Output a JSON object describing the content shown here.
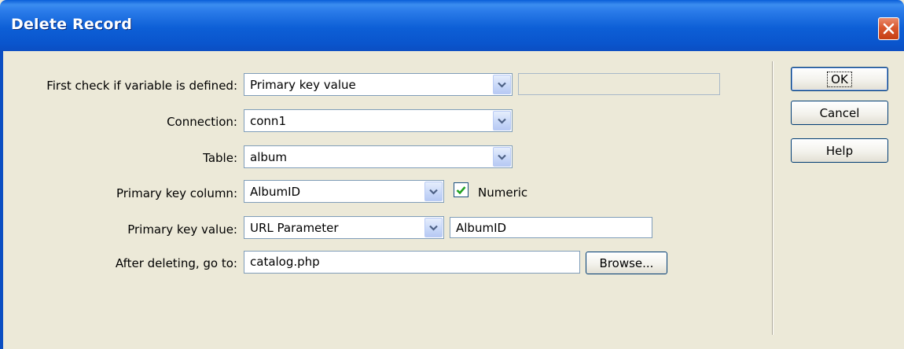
{
  "window": {
    "title": "Delete Record"
  },
  "form": {
    "check_variable": {
      "label": "First check if variable is defined:",
      "selected": "Primary key value",
      "extra_value": ""
    },
    "connection": {
      "label": "Connection:",
      "selected": "conn1"
    },
    "table": {
      "label": "Table:",
      "selected": "album"
    },
    "primary_key_column": {
      "label": "Primary key column:",
      "selected": "AlbumID",
      "numeric_label": "Numeric",
      "numeric_checked": true
    },
    "primary_key_value": {
      "label": "Primary key value:",
      "selected": "URL Parameter",
      "param_value": "AlbumID"
    },
    "after_deleting": {
      "label": "After deleting, go to:",
      "value": "catalog.php",
      "browse_label": "Browse..."
    }
  },
  "buttons": {
    "ok": "OK",
    "cancel": "Cancel",
    "help": "Help"
  },
  "colors": {
    "titlebar": "#0a5ed8",
    "window_bg": "#ece9d8",
    "close_button": "#d9582f",
    "checkmark": "#21a121"
  },
  "icons": {
    "close": "close-icon",
    "dropdown": "chevron-down-icon",
    "check": "checkmark-icon"
  }
}
